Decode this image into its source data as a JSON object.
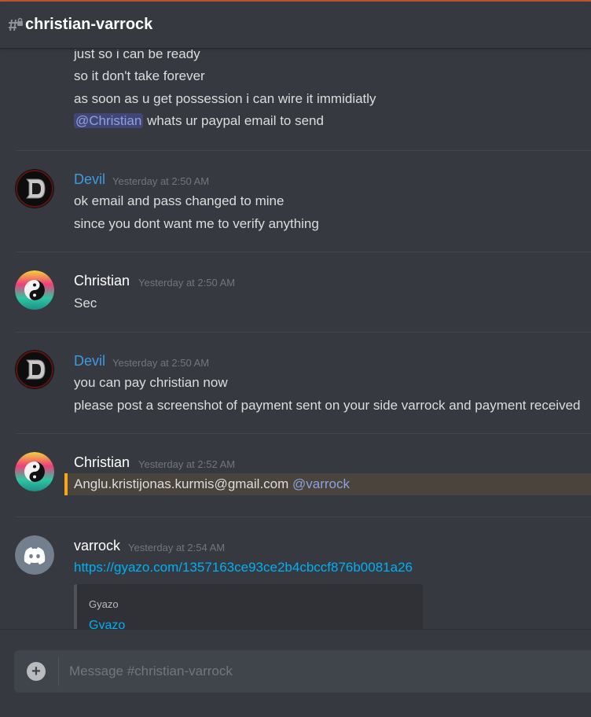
{
  "channel": {
    "name": "christian-varrock",
    "icon": "locked-hash-icon"
  },
  "colors": {
    "accent_mention": "#8ea1e1",
    "devil_role": "#3d9be0",
    "link": "#00b0f4",
    "highlight_bar": "#faa61a"
  },
  "messages": [
    {
      "continuation": true,
      "lines": [
        "just so i can be ready",
        "so it don't take forever",
        "as soon as u get possession i can wire it immidiatly"
      ],
      "mention_line": {
        "mention": "@Christian",
        "text": " whats ur paypal email to send"
      }
    },
    {
      "author": "Devil",
      "timestamp": "Yesterday at 2:50 AM",
      "avatar": "devil-avatar",
      "lines": [
        "ok email and pass changed to mine",
        "since you dont want me to verify anything"
      ]
    },
    {
      "author": "Christian",
      "timestamp": "Yesterday at 2:50 AM",
      "avatar": "yin-yang-avatar",
      "lines": [
        "Sec"
      ]
    },
    {
      "author": "Devil",
      "timestamp": "Yesterday at 2:50 AM",
      "avatar": "devil-avatar",
      "lines": [
        "you can pay christian now",
        "please post a screenshot of payment sent on your side varrock and payment received"
      ]
    },
    {
      "author": "Christian",
      "timestamp": "Yesterday at 2:52 AM",
      "avatar": "yin-yang-avatar",
      "text": "Anglu.kristijonas.kurmis@gmail.com ",
      "mention": "@varrock"
    },
    {
      "author": "varrock",
      "timestamp": "Yesterday at 2:54 AM",
      "avatar": "discord-default-avatar",
      "link": "https://gyazo.com/1357163ce93ce2b4cbccf876b0081a26",
      "embed": {
        "provider": "Gyazo",
        "title": "Gyazo"
      }
    }
  ],
  "composer": {
    "placeholder": "Message #christian-varrock",
    "add_icon": "plus-circle-icon"
  }
}
